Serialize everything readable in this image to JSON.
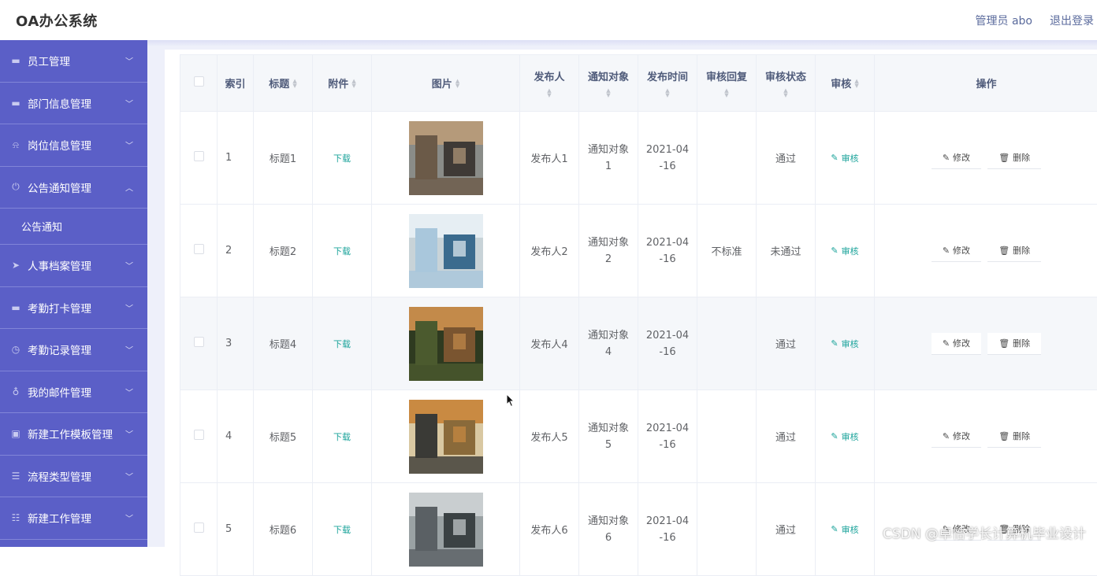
{
  "header": {
    "title": "OA办公系统",
    "user": "管理员 abo",
    "logout": "退出登录"
  },
  "sidebar": {
    "items": [
      {
        "label": "员工管理",
        "icon": "monitor-icon",
        "expanded": false
      },
      {
        "label": "部门信息管理",
        "icon": "monitor-icon",
        "expanded": false
      },
      {
        "label": "岗位信息管理",
        "icon": "bell-icon",
        "expanded": false
      },
      {
        "label": "公告通知管理",
        "icon": "power-icon",
        "expanded": true,
        "sub": [
          "公告通知"
        ]
      },
      {
        "label": "人事档案管理",
        "icon": "send-icon",
        "expanded": false
      },
      {
        "label": "考勤打卡管理",
        "icon": "monitor-icon",
        "expanded": false
      },
      {
        "label": "考勤记录管理",
        "icon": "clock-icon",
        "expanded": false
      },
      {
        "label": "我的邮件管理",
        "icon": "mic-icon",
        "expanded": false
      },
      {
        "label": "新建工作模板管理",
        "icon": "clipboard-icon",
        "expanded": false
      },
      {
        "label": "流程类型管理",
        "icon": "list-icon",
        "expanded": false
      },
      {
        "label": "新建工作管理",
        "icon": "sliders-icon",
        "expanded": false
      }
    ]
  },
  "table": {
    "headers": {
      "index": "索引",
      "title": "标题",
      "attachment": "附件",
      "image": "图片",
      "publisher": "发布人",
      "target": "通知对象",
      "time": "发布时间",
      "reply": "审核回复",
      "status": "审核状态",
      "audit": "审核",
      "ops": "操作"
    },
    "rows": [
      {
        "index": "1",
        "title": "标题1",
        "attachment": "下载",
        "publisher": "发布人1",
        "target1": "通知对象",
        "target2": "1",
        "time1": "2021-04",
        "time2": "-16",
        "reply": "",
        "status": "通过",
        "audit": "审核",
        "edit": "修改",
        "delete": "删除",
        "image_palette": [
          "#6b5a48",
          "#b59a7a",
          "#3f3a36",
          "#8a8c88"
        ]
      },
      {
        "index": "2",
        "title": "标题2",
        "attachment": "下载",
        "publisher": "发布人2",
        "target1": "通知对象",
        "target2": "2",
        "time1": "2021-04",
        "time2": "-16",
        "reply": "不标准",
        "status": "未通过",
        "audit": "审核",
        "edit": "修改",
        "delete": "删除",
        "image_palette": [
          "#a9c7dc",
          "#e6eef3",
          "#3b6b8e",
          "#c8d3d8"
        ]
      },
      {
        "index": "3",
        "title": "标题4",
        "attachment": "下载",
        "publisher": "发布人4",
        "target1": "通知对象",
        "target2": "4",
        "time1": "2021-04",
        "time2": "-16",
        "reply": "",
        "status": "通过",
        "audit": "审核",
        "edit": "修改",
        "delete": "删除",
        "image_palette": [
          "#4b5a2e",
          "#c38a4a",
          "#7a5530",
          "#2e3a20"
        ]
      },
      {
        "index": "4",
        "title": "标题5",
        "attachment": "下载",
        "publisher": "发布人5",
        "target1": "通知对象",
        "target2": "5",
        "time1": "2021-04",
        "time2": "-16",
        "reply": "",
        "status": "通过",
        "audit": "审核",
        "edit": "修改",
        "delete": "删除",
        "image_palette": [
          "#3a3a36",
          "#c98a42",
          "#8a6a3a",
          "#d9c8a2"
        ]
      },
      {
        "index": "5",
        "title": "标题6",
        "attachment": "下载",
        "publisher": "发布人6",
        "target1": "通知对象",
        "target2": "6",
        "time1": "2021-04",
        "time2": "-16",
        "reply": "",
        "status": "通过",
        "audit": "审核",
        "edit": "修改",
        "delete": "删除",
        "image_palette": [
          "#5a6064",
          "#c9ced0",
          "#3b4244",
          "#9aa2a4"
        ]
      }
    ]
  },
  "watermark": "CSDN @卓怡学长计算机毕业设计",
  "colors": {
    "sidebar": "#5b5fc7",
    "accent": "#1aa39a",
    "header_text": "#5a6a9c"
  }
}
